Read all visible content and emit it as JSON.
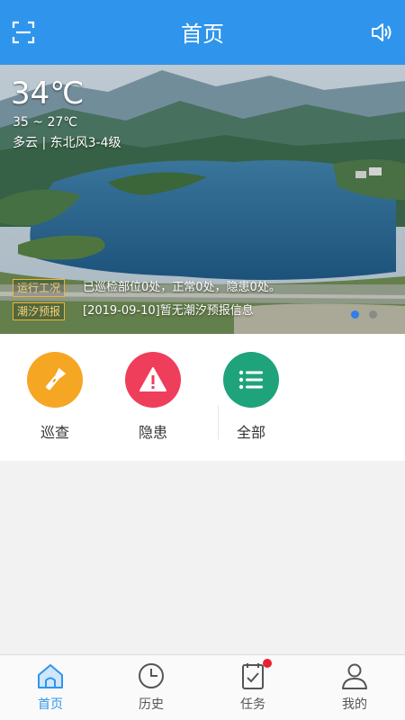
{
  "header": {
    "title": "首页",
    "left_icon": "scan-icon",
    "right_icon": "speaker-icon",
    "bg_color": "#2f95ec"
  },
  "weather": {
    "temperature": "34℃",
    "range": "35 ~ 27℃",
    "condition": "多云 | 东北风3-4级"
  },
  "notices": [
    {
      "tag": "运行工况",
      "text": "已巡检部位0处，正常0处，隐患0处。"
    },
    {
      "tag": "潮汐预报",
      "text": "[2019-09-10]暂无潮汐预报信息"
    }
  ],
  "carousel": {
    "count": 2,
    "active_index": 0,
    "active_color": "#2f7fe6",
    "inactive_color": "#8a8a8a"
  },
  "quick_actions": [
    {
      "label": "巡查",
      "icon": "flashlight-icon",
      "color": "#f5a623"
    },
    {
      "label": "隐患",
      "icon": "warning-icon",
      "color": "#ef3e5c"
    },
    {
      "label": "全部",
      "icon": "list-icon",
      "color": "#1fa37a"
    }
  ],
  "tabs": [
    {
      "label": "首页",
      "icon": "home-icon",
      "active": true
    },
    {
      "label": "历史",
      "icon": "clock-icon",
      "active": false
    },
    {
      "label": "任务",
      "icon": "task-clipboard-icon",
      "active": false,
      "badge": true
    },
    {
      "label": "我的",
      "icon": "user-icon",
      "active": false
    }
  ]
}
